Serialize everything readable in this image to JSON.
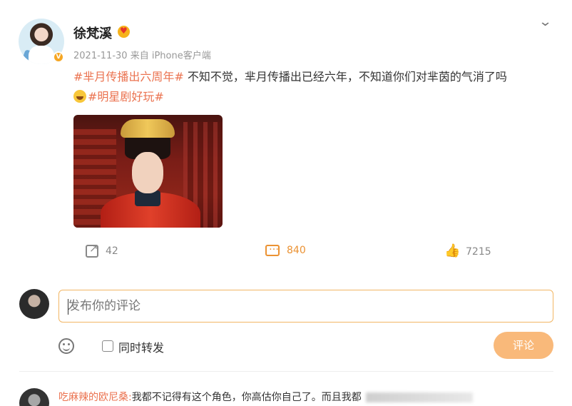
{
  "post": {
    "username": "徐梵溪",
    "verified_badge": "V",
    "timestamp": "2021-11-30",
    "source": "来自 iPhone客户端",
    "tag1": "#芈月传播出六周年#",
    "text1": " 不知不觉，芈月传播出已经六年，不知道你们对芈茵的气消了吗",
    "tag2": "#明星剧好玩#",
    "image_alt": "costume drama still"
  },
  "actions": {
    "share_count": "42",
    "comment_count": "840",
    "like_count": "7215"
  },
  "comment_box": {
    "placeholder": "发布你的评论",
    "repost_label": "同时转发",
    "submit_label": "评论"
  },
  "comments": [
    {
      "user": "吃麻辣的欧尼桑:",
      "text": "我都不记得有这个角色，你高估你自己了。而且我都"
    }
  ],
  "icons": [
    "chevron-down-icon",
    "share-icon",
    "comment-icon",
    "like-icon",
    "emoji-icon"
  ],
  "colors": {
    "accent": "#eb7350",
    "comment_orange": "#eb9233",
    "button": "#f9b97a"
  }
}
